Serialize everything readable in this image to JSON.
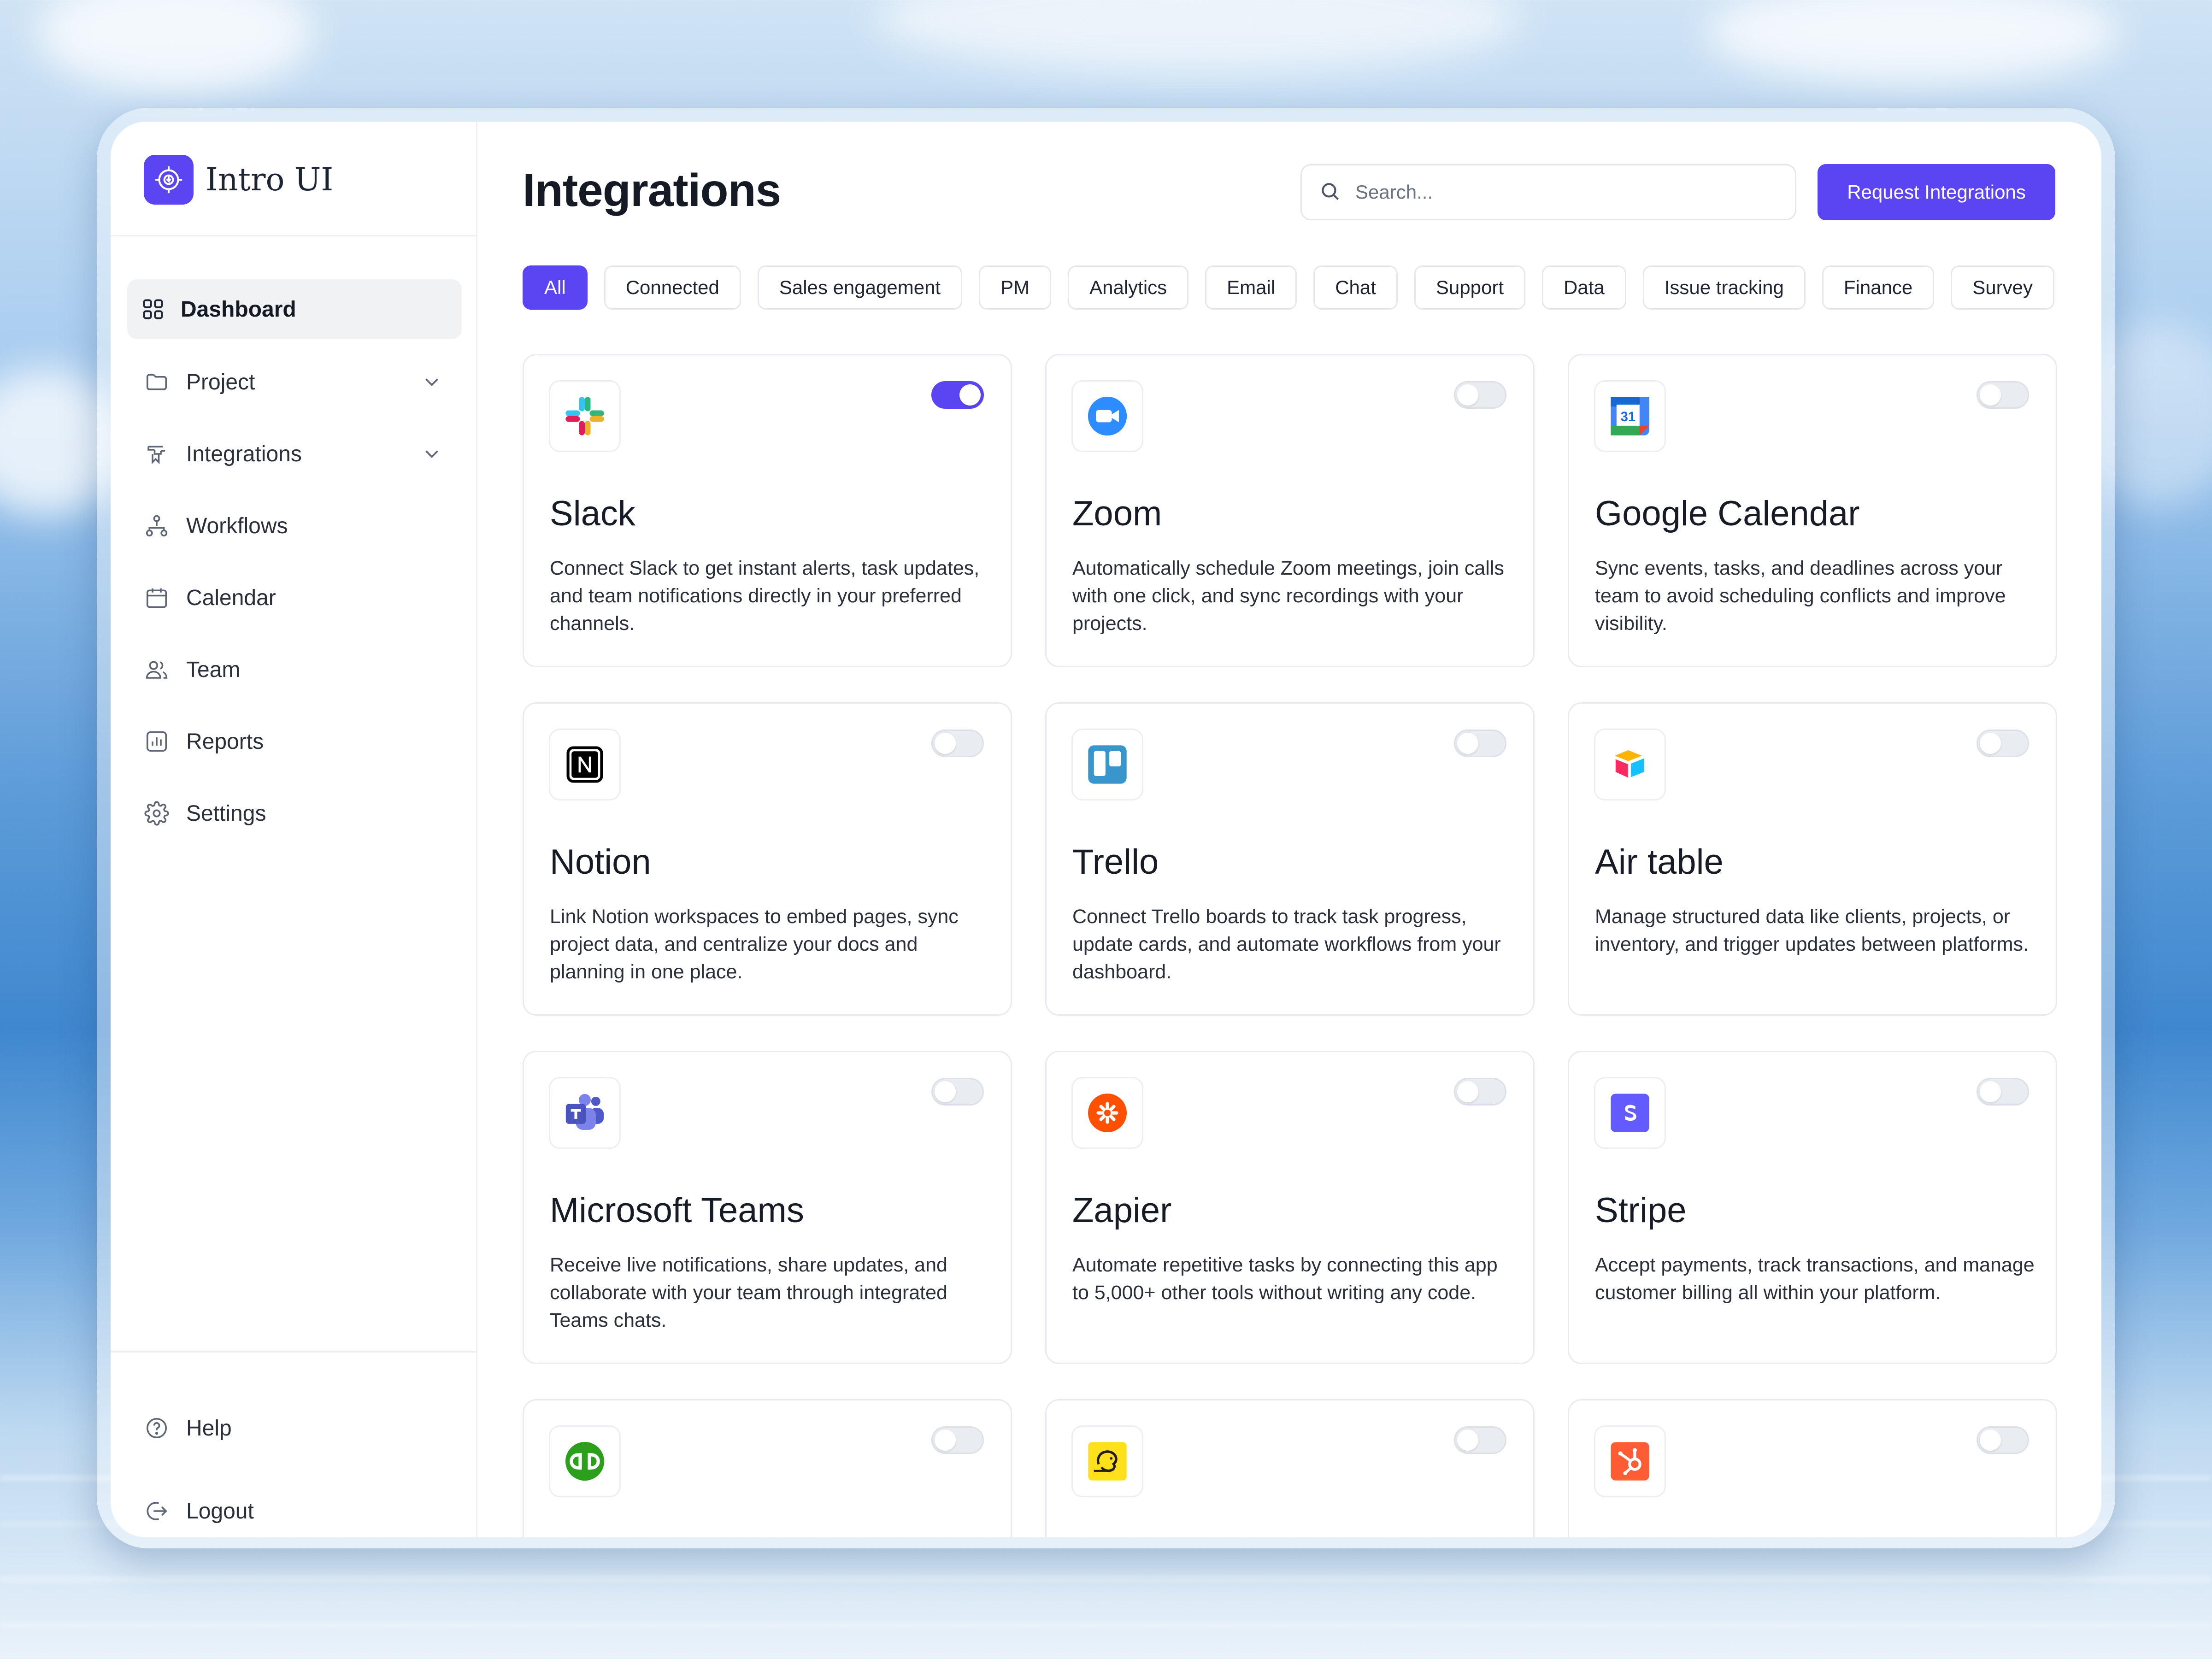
{
  "brand": {
    "name": "Intro UI"
  },
  "sidebar": {
    "items": [
      {
        "label": "Dashboard",
        "icon": "grid-icon"
      },
      {
        "label": "Project",
        "icon": "folder-icon"
      },
      {
        "label": "Integrations",
        "icon": "integrations-icon"
      },
      {
        "label": "Workflows",
        "icon": "workflow-icon"
      },
      {
        "label": "Calendar",
        "icon": "calendar-icon"
      },
      {
        "label": "Team",
        "icon": "team-icon"
      },
      {
        "label": "Reports",
        "icon": "reports-icon"
      },
      {
        "label": "Settings",
        "icon": "gear-icon"
      }
    ],
    "footer": [
      {
        "label": "Help",
        "icon": "help-icon"
      },
      {
        "label": "Logout",
        "icon": "logout-icon"
      }
    ]
  },
  "header": {
    "title": "Integrations",
    "search_placeholder": "Search...",
    "request_button": "Request Integrations"
  },
  "filters": [
    "All",
    "Connected",
    "Sales engagement",
    "PM",
    "Analytics",
    "Email",
    "Chat",
    "Support",
    "Data",
    "Issue tracking",
    "Finance",
    "Survey"
  ],
  "active_filter": "All",
  "accent_color": "#5b45f2",
  "cards": [
    {
      "name": "Slack",
      "desc": "Connect Slack to get instant alerts, task updates, and team notifications directly in your preferred channels.",
      "enabled": true,
      "icon": "slack-logo"
    },
    {
      "name": "Zoom",
      "desc": "Automatically schedule Zoom meetings, join calls with one click, and sync recordings with your projects.",
      "enabled": false,
      "icon": "zoom-logo"
    },
    {
      "name": "Google Calendar",
      "desc": "Sync events, tasks, and deadlines across your team to avoid scheduling conflicts and improve visibility.",
      "enabled": false,
      "icon": "google-calendar-logo"
    },
    {
      "name": "Notion",
      "desc": "Link Notion workspaces to embed pages, sync project data, and centralize your docs and planning in one place.",
      "enabled": false,
      "icon": "notion-logo"
    },
    {
      "name": "Trello",
      "desc": "Connect Trello boards to track task progress, update cards, and automate workflows from your dashboard.",
      "enabled": false,
      "icon": "trello-logo"
    },
    {
      "name": "Air table",
      "desc": "Manage structured data like clients, projects, or inventory, and trigger updates between platforms.",
      "enabled": false,
      "icon": "airtable-logo"
    },
    {
      "name": "Microsoft Teams",
      "desc": "Receive live notifications, share updates, and collaborate with your team through integrated Teams chats.",
      "enabled": false,
      "icon": "teams-logo"
    },
    {
      "name": "Zapier",
      "desc": "Automate repetitive tasks by connecting this app to 5,000+ other tools without writing any code.",
      "enabled": false,
      "icon": "zapier-logo"
    },
    {
      "name": "Stripe",
      "desc": "Accept payments, track transactions, and manage customer billing all within your platform.",
      "enabled": false,
      "icon": "stripe-logo"
    },
    {
      "name": "",
      "desc": "",
      "enabled": false,
      "icon": "quickbooks-logo"
    },
    {
      "name": "",
      "desc": "",
      "enabled": false,
      "icon": "mailchimp-logo"
    },
    {
      "name": "",
      "desc": "",
      "enabled": false,
      "icon": "hubspot-logo"
    }
  ]
}
